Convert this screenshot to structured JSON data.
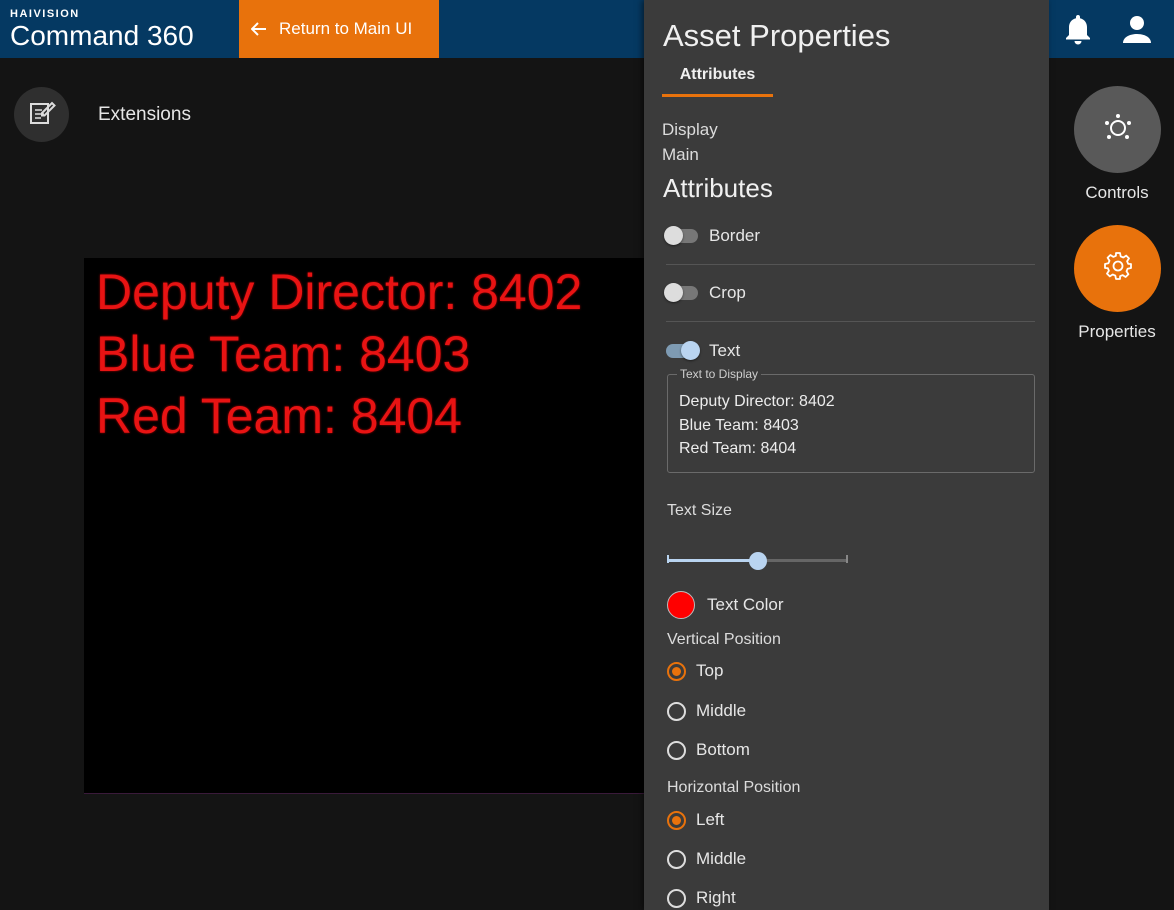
{
  "header": {
    "brand_small": "HAIVISION",
    "brand_big": "Command 360",
    "return_label": "Return to Main UI",
    "bell_icon": "bell-icon",
    "user_icon": "user-icon",
    "accent_color": "#e8720c",
    "bar_color": "#053962"
  },
  "left": {
    "extensions_label": "Extensions",
    "preview_lines": [
      "Deputy Director: 8402",
      "Blue Team: 8403",
      "Red Team: 8404"
    ]
  },
  "rail": {
    "controls_label": "Controls",
    "properties_label": "Properties"
  },
  "panel": {
    "title": "Asset Properties",
    "tab": "Attributes",
    "display_label": "Display",
    "display_value": "Main",
    "section_title": "Attributes",
    "toggles": [
      {
        "label": "Border",
        "on": false
      },
      {
        "label": "Crop",
        "on": false
      },
      {
        "label": "Text",
        "on": true
      }
    ],
    "text_to_display_label": "Text to Display",
    "text_to_display_value": "Deputy Director: 8402\nBlue Team: 8403\nRed Team: 8404",
    "text_size_label": "Text Size",
    "text_size_value": 0.5,
    "text_color_label": "Text Color",
    "text_color": "#ff0000",
    "vertical_label": "Vertical Position",
    "vertical_options": [
      "Top",
      "Middle",
      "Bottom"
    ],
    "vertical_selected": "Top",
    "horizontal_label": "Horizontal Position",
    "horizontal_options": [
      "Left",
      "Middle",
      "Right"
    ],
    "horizontal_selected": "Left"
  }
}
